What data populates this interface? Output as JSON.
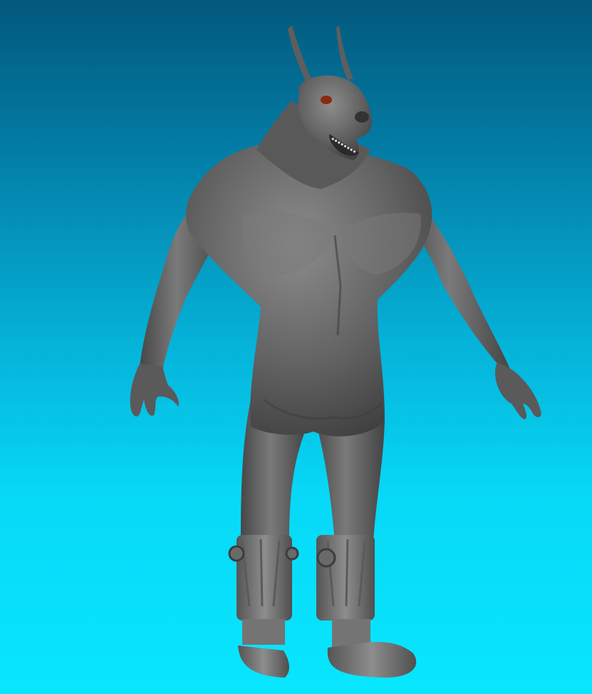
{
  "scene": {
    "subject": "sculpted-doberman-werewolf-figure",
    "background": {
      "top_color": "#03597d",
      "bottom_color": "#08e6ff"
    },
    "model_color": "#5f5f5f",
    "eye_color": "#8a2a10"
  }
}
